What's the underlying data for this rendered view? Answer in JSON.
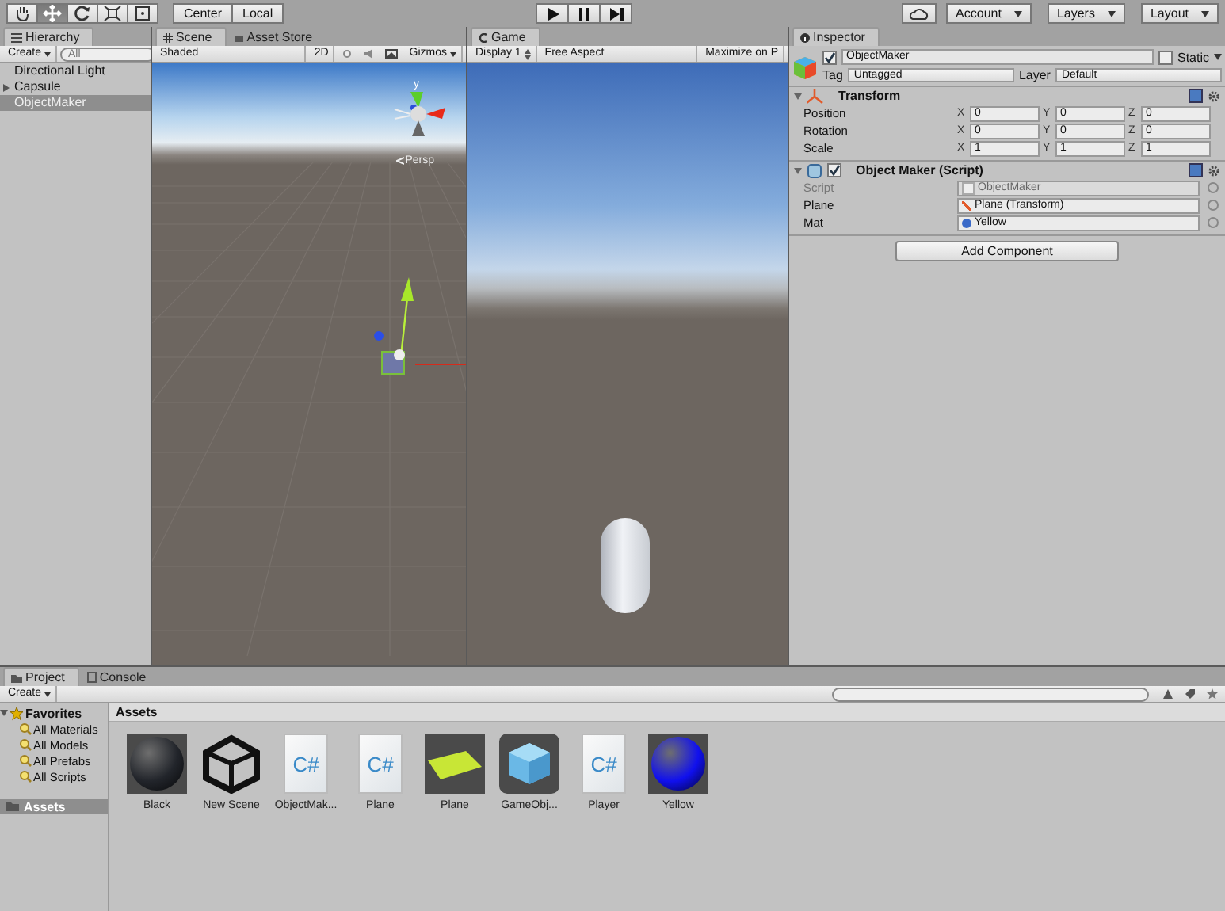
{
  "toolbar": {
    "tools": [
      {
        "kind": "hand",
        "selected": false
      },
      {
        "kind": "move",
        "selected": true
      },
      {
        "kind": "rotate",
        "selected": false
      },
      {
        "kind": "scale",
        "selected": false
      },
      {
        "kind": "rect",
        "selected": false
      }
    ],
    "pivot": [
      "Center",
      "Local"
    ],
    "right": [
      "Account",
      "Layers",
      "Layout"
    ]
  },
  "hierarchy": {
    "tab": "Hierarchy",
    "create": "Create",
    "search_placeholder": "All",
    "items": [
      {
        "label": "Directional Light",
        "kind": "leaf",
        "selected": false
      },
      {
        "label": "Capsule",
        "kind": "parent",
        "selected": false
      },
      {
        "label": "ObjectMaker",
        "kind": "leaf",
        "selected": true
      }
    ]
  },
  "scene": {
    "tabs": [
      {
        "label": "Scene",
        "kind": "scene",
        "selected": true
      },
      {
        "label": "Asset Store",
        "kind": "store",
        "selected": false
      }
    ],
    "shading": "Shaded",
    "mode_2d": "2D",
    "gizmos": "Gizmos",
    "axis_label": "y",
    "projection": "Persp"
  },
  "game": {
    "tab": "Game",
    "display": "Display 1",
    "aspect": "Free Aspect",
    "maximize": "Maximize on P"
  },
  "inspector": {
    "tab": "Inspector",
    "name": "ObjectMaker",
    "active": true,
    "static_label": "Static",
    "static": false,
    "tag_label": "Tag",
    "tag": "Untagged",
    "layer_label": "Layer",
    "layer": "Default",
    "transform": {
      "title": "Transform",
      "rows": [
        {
          "label": "Position",
          "cells": [
            {
              "axis": "X",
              "value": "0"
            },
            {
              "axis": "Y",
              "value": "0"
            },
            {
              "axis": "Z",
              "value": "0"
            }
          ]
        },
        {
          "label": "Rotation",
          "cells": [
            {
              "axis": "X",
              "value": "0"
            },
            {
              "axis": "Y",
              "value": "0"
            },
            {
              "axis": "Z",
              "value": "0"
            }
          ]
        },
        {
          "label": "Scale",
          "cells": [
            {
              "axis": "X",
              "value": "1"
            },
            {
              "axis": "Y",
              "value": "1"
            },
            {
              "axis": "Z",
              "value": "1"
            }
          ]
        }
      ]
    },
    "script": {
      "title": "Object Maker (Script)",
      "enabled": true,
      "fields": [
        {
          "label": "Script",
          "value": "ObjectMaker",
          "kind": "script",
          "disabled": true
        },
        {
          "label": "Plane",
          "value": "Plane (Transform)",
          "kind": "transform",
          "disabled": false
        },
        {
          "label": "Mat",
          "value": "Yellow",
          "kind": "material",
          "disabled": false
        }
      ]
    },
    "add_button": "Add Component"
  },
  "project": {
    "tabs": [
      {
        "label": "Project",
        "kind": "project",
        "selected": true
      },
      {
        "label": "Console",
        "kind": "console",
        "selected": false
      }
    ],
    "create": "Create",
    "favorites": "Favorites",
    "favorite_items": [
      "All Materials",
      "All Models",
      "All Prefabs",
      "All Scripts"
    ],
    "folders": [
      {
        "label": "Assets",
        "selected": true
      }
    ],
    "breadcrumb": "Assets",
    "assets": [
      {
        "label": "Black",
        "kind": "material",
        "color": "#22252b"
      },
      {
        "label": "New Scene",
        "kind": "scene"
      },
      {
        "label": "ObjectMak...",
        "kind": "script",
        "icon_text": "C#"
      },
      {
        "label": "Plane",
        "kind": "script",
        "icon_text": "C#"
      },
      {
        "label": "Plane",
        "kind": "model"
      },
      {
        "label": "GameObj...",
        "kind": "prefab"
      },
      {
        "label": "Player",
        "kind": "script",
        "icon_text": "C#"
      },
      {
        "label": "Yellow",
        "kind": "material",
        "color": "#1010ee"
      }
    ]
  }
}
